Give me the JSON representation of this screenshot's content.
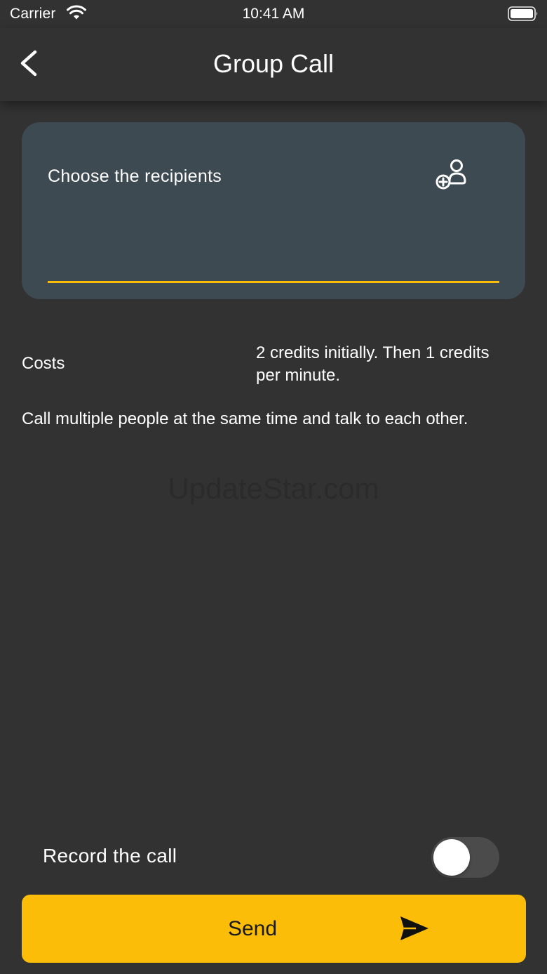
{
  "status_bar": {
    "carrier": "Carrier",
    "time": "10:41 AM",
    "icons": [
      "wifi-icon",
      "battery-icon"
    ]
  },
  "nav": {
    "title": "Group Call",
    "back_icon": "chevron-left-icon"
  },
  "recipients": {
    "label": "Choose the recipients",
    "icon": "add-person-icon"
  },
  "costs": {
    "label": "Costs",
    "value": "2 credits initially. Then 1 credits per minute."
  },
  "description": "Call multiple people at the same time and talk to each other.",
  "watermark": "UpdateStar.com",
  "record": {
    "label": "Record the call",
    "enabled": false
  },
  "send": {
    "label": "Send",
    "icon": "send-icon"
  },
  "colors": {
    "background": "#323232",
    "card": "#3e4a52",
    "accent": "#fbbd08",
    "text": "#ffffff"
  }
}
